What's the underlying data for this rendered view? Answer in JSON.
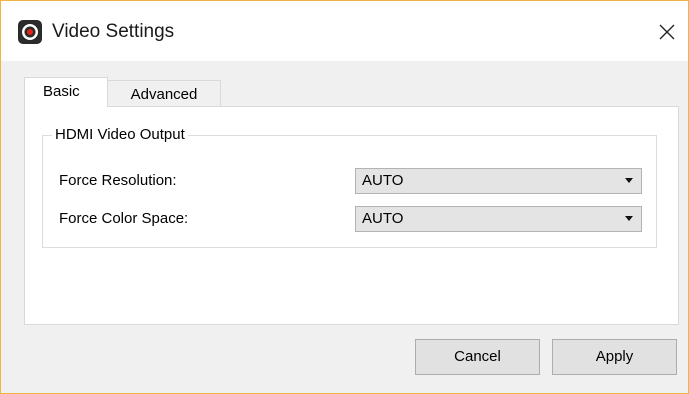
{
  "window": {
    "title": "Video Settings",
    "app_icon": "camera-app-icon",
    "close_icon": "close-icon"
  },
  "tabs": [
    {
      "label": "Basic",
      "selected": true
    },
    {
      "label": "Advanced",
      "selected": false
    }
  ],
  "group": {
    "title": "HDMI Video Output",
    "fields": [
      {
        "label": "Force Resolution:",
        "value": "AUTO"
      },
      {
        "label": "Force Color Space:",
        "value": "AUTO"
      }
    ]
  },
  "buttons": {
    "cancel": "Cancel",
    "apply": "Apply"
  },
  "colors": {
    "window_border": "#f0b443",
    "app_icon_bg": "#2b2b2b",
    "app_icon_accent": "#e2231a"
  }
}
